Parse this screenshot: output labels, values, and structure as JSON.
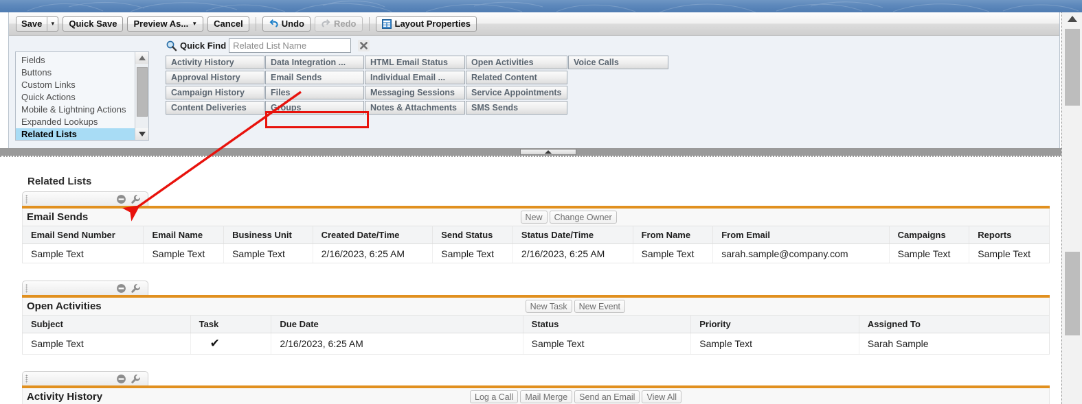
{
  "toolbar": {
    "save": "Save",
    "quick_save": "Quick Save",
    "preview_as": "Preview As...",
    "cancel": "Cancel",
    "undo": "Undo",
    "redo": "Redo",
    "layout_properties": "Layout Properties"
  },
  "sidebar": {
    "items": [
      {
        "label": "Fields",
        "selected": false
      },
      {
        "label": "Buttons",
        "selected": false
      },
      {
        "label": "Custom Links",
        "selected": false
      },
      {
        "label": "Quick Actions",
        "selected": false
      },
      {
        "label": "Mobile & Lightning Actions",
        "selected": false
      },
      {
        "label": "Expanded Lookups",
        "selected": false
      },
      {
        "label": "Related Lists",
        "selected": true
      }
    ]
  },
  "quick_find": {
    "label": "Quick Find",
    "placeholder": "Related List Name",
    "value": ""
  },
  "palette": {
    "rows": [
      [
        "Activity History",
        "Data Integration ...",
        "HTML Email Status",
        "Open Activities",
        "Voice Calls"
      ],
      [
        "Approval History",
        "Email Sends",
        "Individual Email ...",
        "Related Content",
        ""
      ],
      [
        "Campaign History",
        "Files",
        "Messaging Sessions",
        "Service Appointments",
        ""
      ],
      [
        "Content Deliveries",
        "Groups",
        "Notes & Attachments",
        "SMS Sends",
        ""
      ]
    ],
    "highlighted": "Email Sends"
  },
  "preview": {
    "section_title": "Related Lists",
    "accent_color": "#e1901f",
    "highlight_color": "#e8120c",
    "related_lists": [
      {
        "name": "Email Sends",
        "actions": [
          "New",
          "Change Owner"
        ],
        "columns": [
          "Email Send Number",
          "Email Name",
          "Business Unit",
          "Created Date/Time",
          "Send Status",
          "Status Date/Time",
          "From Name",
          "From Email",
          "Campaigns",
          "Reports"
        ],
        "rows": [
          [
            "Sample Text",
            "Sample Text",
            "Sample Text",
            "2/16/2023, 6:25 AM",
            "Sample Text",
            "2/16/2023, 6:25 AM",
            "Sample Text",
            "sarah.sample@company.com",
            "Sample Text",
            "Sample Text"
          ]
        ]
      },
      {
        "name": "Open Activities",
        "actions": [
          "New Task",
          "New Event"
        ],
        "columns": [
          "Subject",
          "Task",
          "Due Date",
          "Status",
          "Priority",
          "Assigned To"
        ],
        "rows": [
          [
            "Sample Text",
            "✔",
            "2/16/2023, 6:25 AM",
            "Sample Text",
            "Sample Text",
            "Sarah Sample"
          ]
        ]
      },
      {
        "name": "Activity History",
        "actions": [
          "Log a Call",
          "Mail Merge",
          "Send an Email",
          "View All"
        ],
        "columns": [],
        "rows": []
      }
    ]
  }
}
